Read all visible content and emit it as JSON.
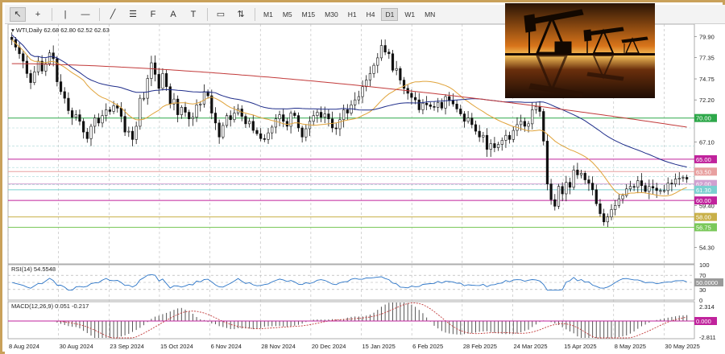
{
  "toolbar": {
    "tools": [
      {
        "name": "cursor-icon",
        "glyph": "↖"
      },
      {
        "name": "crosshair-icon",
        "glyph": "+"
      },
      {
        "name": "vertical-line-icon",
        "glyph": "|"
      },
      {
        "name": "horizontal-line-icon",
        "glyph": "—"
      },
      {
        "name": "trendline-icon",
        "glyph": "╱"
      },
      {
        "name": "channel-icon",
        "glyph": "☰"
      },
      {
        "name": "fibonacci-icon",
        "glyph": "F"
      },
      {
        "name": "text-icon",
        "glyph": "A"
      },
      {
        "name": "label-icon",
        "glyph": "T"
      },
      {
        "name": "shapes-icon",
        "glyph": "▭"
      },
      {
        "name": "arrows-icon",
        "glyph": "⇅"
      }
    ],
    "timeframes": [
      "M1",
      "M5",
      "M15",
      "M30",
      "H1",
      "H4",
      "D1",
      "W1",
      "MN"
    ],
    "active_timeframe": "D1"
  },
  "header": {
    "symbol_line": "WTI,Daily  62.68 62.80 62.52 62.63"
  },
  "rsi": {
    "label": "RSI(14) 54.5548",
    "scale": [
      "100",
      "70",
      "50.0000",
      "30",
      "0"
    ]
  },
  "macd": {
    "label": "MACD(12,26,9) 0.051 -0.217",
    "scale": [
      "2.314",
      "0.000",
      "-2.811"
    ]
  },
  "price_scale": [
    "79.90",
    "77.35",
    "74.75",
    "72.20",
    "67.10",
    "59.40",
    "54.30"
  ],
  "levels": [
    {
      "label": "70.00",
      "color": "#2ea84a"
    },
    {
      "label": "65.00",
      "color": "#c0239c"
    },
    {
      "label": "63.50",
      "color": "#e8a0a0"
    },
    {
      "label": "62.00",
      "color": "#d0a0d0"
    },
    {
      "label": "61.30",
      "color": "#7ad0d0"
    },
    {
      "label": "60.00",
      "color": "#c0239c"
    },
    {
      "label": "58.00",
      "color": "#c8b048"
    },
    {
      "label": "56.75",
      "color": "#7ac85a"
    }
  ],
  "dates": [
    "8 Aug 2024",
    "30 Aug 2024",
    "23 Sep 2024",
    "15 Oct 2024",
    "6 Nov 2024",
    "28 Nov 2024",
    "20 Dec 2024",
    "15 Jan 2025",
    "6 Feb 2025",
    "28 Feb 2025",
    "24 Mar 2025",
    "15 Apr 2025",
    "8 May 2025",
    "30 May 2025"
  ],
  "chart_data": {
    "type": "candlestick",
    "ylim": [
      52.5,
      81.0
    ],
    "closes": [
      79.5,
      78.6,
      77.8,
      76.9,
      75.4,
      74.3,
      75.6,
      76.9,
      75.7,
      76.6,
      77.9,
      77.2,
      74.4,
      73.2,
      72.4,
      70.9,
      70.1,
      70.4,
      69.6,
      68.3,
      67.5,
      69.0,
      70.0,
      69.4,
      70.3,
      71.0,
      70.8,
      71.5,
      71.2,
      70.2,
      68.3,
      68.4,
      67.4,
      69.0,
      72.4,
      72.4,
      74.8,
      76.7,
      75.3,
      73.6,
      75.4,
      73.8,
      71.7,
      72.3,
      70.4,
      71.3,
      70.7,
      69.9,
      70.1,
      71.6,
      71.7,
      73.2,
      72.7,
      70.6,
      69.4,
      67.7,
      69.1,
      70.3,
      69.8,
      70.6,
      71.1,
      70.2,
      69.3,
      69.6,
      68.5,
      68.1,
      67.5,
      67.4,
      68.2,
      68.9,
      69.9,
      70.4,
      69.6,
      69.0,
      70.6,
      70.3,
      68.8,
      67.7,
      68.7,
      69.6,
      70.3,
      70.7,
      70.1,
      70.5,
      69.9,
      68.8,
      68.7,
      69.8,
      71.0,
      70.6,
      71.6,
      72.2,
      72.6,
      73.8,
      74.6,
      75.4,
      76.4,
      77.3,
      78.8,
      78.0,
      77.8,
      75.8,
      76.0,
      74.6,
      73.6,
      73.0,
      72.5,
      72.2,
      71.0,
      71.8,
      71.6,
      71.4,
      71.3,
      71.9,
      71.2,
      72.6,
      72.1,
      71.7,
      71.1,
      70.5,
      69.6,
      70.0,
      69.2,
      68.4,
      67.7,
      67.9,
      66.2,
      66.9,
      66.4,
      66.8,
      67.3,
      67.9,
      67.4,
      68.5,
      69.2,
      69.6,
      69.0,
      69.3,
      71.0,
      71.4,
      70.8,
      67.2,
      62.0,
      60.1,
      59.3,
      61.7,
      60.8,
      62.2,
      61.6,
      63.7,
      63.1,
      63.3,
      62.5,
      62.1,
      61.3,
      59.6,
      58.4,
      57.4,
      58.0,
      58.9,
      59.4,
      60.2,
      60.6,
      61.4,
      61.7,
      61.6,
      62.4,
      61.8,
      61.1,
      61.7,
      61.5,
      61.2,
      61.2,
      61.2,
      62.1,
      62.0,
      62.6,
      62.7,
      62.8,
      62.6
    ]
  }
}
